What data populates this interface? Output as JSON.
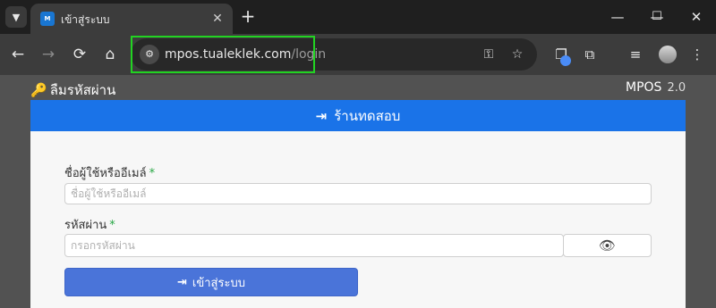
{
  "browser": {
    "tab": {
      "favicon_text": "M",
      "title": "เข้าสู่ระบบ"
    },
    "window_controls": {
      "minimize": "—",
      "maximize": "☐",
      "close": "✕"
    },
    "address": {
      "host": "mpos.tualeklek.com",
      "path": "/login"
    },
    "highlight_color": "#22d322"
  },
  "page": {
    "forgot_password": "ลืมรหัสผ่าน",
    "brand": "MPOS",
    "version": "2.0",
    "store_name": "ร้านทดสอบ",
    "accent_color": "#1a73e8"
  },
  "form": {
    "username_label": "ชื่อผู้ใช้หรืออีเมล์",
    "username_placeholder": "ชื่อผู้ใช้หรืออีเมล์",
    "password_label": "รหัสผ่าน",
    "password_placeholder": "กรอกรหัสผ่าน",
    "required_mark": "*",
    "submit_label": "เข้าสู่ระบบ"
  }
}
